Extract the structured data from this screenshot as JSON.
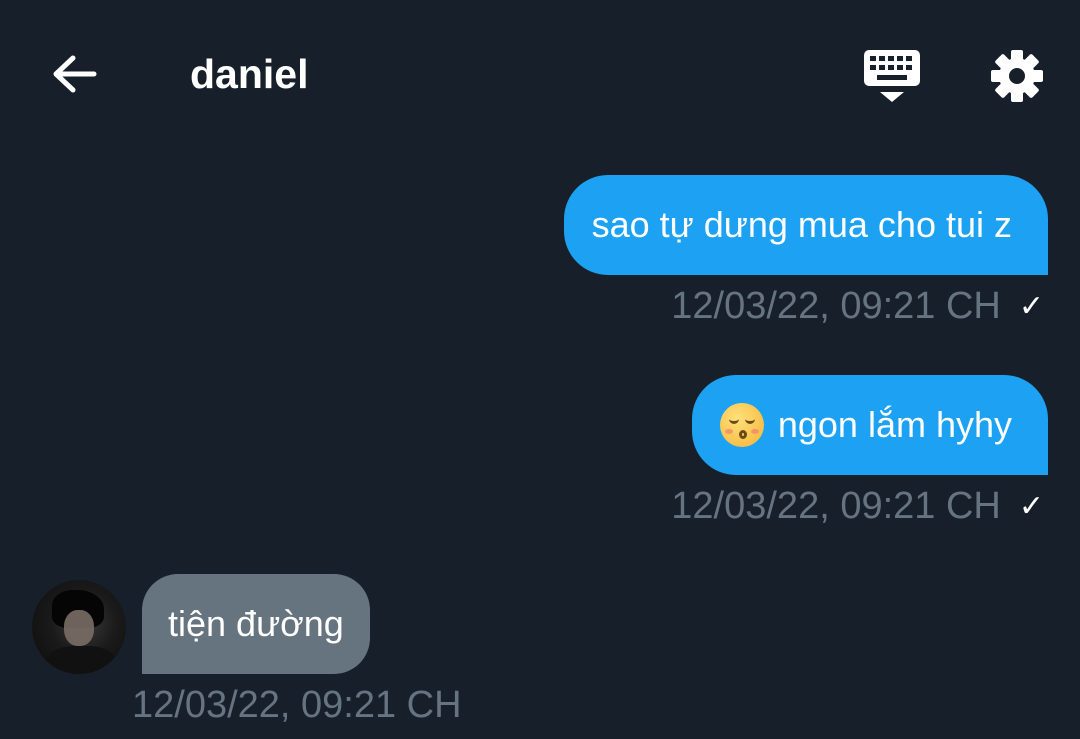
{
  "header": {
    "back_icon": "arrow-left-icon",
    "title": "daniel",
    "keyboard_icon": "keyboard-icon",
    "settings_icon": "gear-icon"
  },
  "colors": {
    "background": "#17202a",
    "outgoing_bubble": "#1da1f2",
    "incoming_bubble": "#66747f",
    "meta_text": "#66747f"
  },
  "messages": [
    {
      "direction": "outgoing",
      "text": "sao tự dưng mua cho tui z",
      "timestamp": "12/03/22, 09:21 CH",
      "status_icon": "checkmark-icon",
      "status": "✓"
    },
    {
      "direction": "outgoing",
      "emoji_icon": "kissing-smiling-eyes-emoji",
      "text": "ngon lắm hyhy",
      "timestamp": "12/03/22, 09:21 CH",
      "status_icon": "checkmark-icon",
      "status": "✓"
    },
    {
      "direction": "incoming",
      "text": "tiện đường",
      "timestamp": "12/03/22, 09:21 CH",
      "avatar_icon": "user-avatar"
    }
  ]
}
